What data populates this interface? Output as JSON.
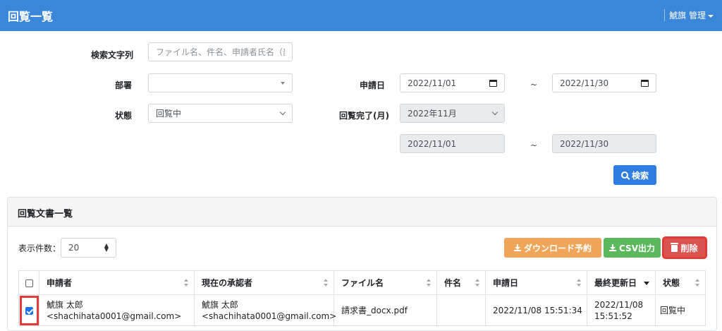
{
  "header": {
    "title": "回覧一覧",
    "user": "鯱旗 管理"
  },
  "search": {
    "keyword_label": "検索文字列",
    "keyword_placeholder": "ファイル名、件名、申請者氏名（部分",
    "dept_label": "部署",
    "dept_value": "",
    "status_label": "状態",
    "status_value": "回覧中",
    "apply_date_label": "申請日",
    "apply_from": "2022/11/01",
    "apply_to": "2022/11/30",
    "tilde": "~",
    "complete_label": "回覧完了(月)",
    "complete_month": "2022年11月",
    "complete_from": "2022/11/01",
    "complete_to": "2022/11/30",
    "search_button": "検索"
  },
  "card": {
    "title": "回覧文書一覧",
    "page_size_label": "表示件数：",
    "page_size_value": "20",
    "download_button": "ダウンロード予約",
    "csv_button": "CSV出力",
    "delete_button": "削除"
  },
  "table": {
    "columns": [
      "申請者",
      "現在の承認者",
      "ファイル名",
      "件名",
      "申請日",
      "最終更新日",
      "状態"
    ],
    "rows": [
      {
        "applicant_name": "鯱旗 太郎",
        "applicant_email": "<shachihata0001@gmail.com>",
        "approver_name": "鯱旗 太郎",
        "approver_email": "<shachihata0001@gmail.com>",
        "file": "請求書_docx.pdf",
        "subject": "",
        "apply_date": "2022/11/08 15:51:34",
        "updated_date": "2022/11/08",
        "updated_time": "15:51:52",
        "status": "回覧中",
        "checked": true
      }
    ]
  },
  "colors": {
    "primary": "#3a86d9",
    "download": "#f0a65a",
    "csv": "#5cb85c",
    "delete": "#d9534f",
    "highlight": "#e53935"
  }
}
